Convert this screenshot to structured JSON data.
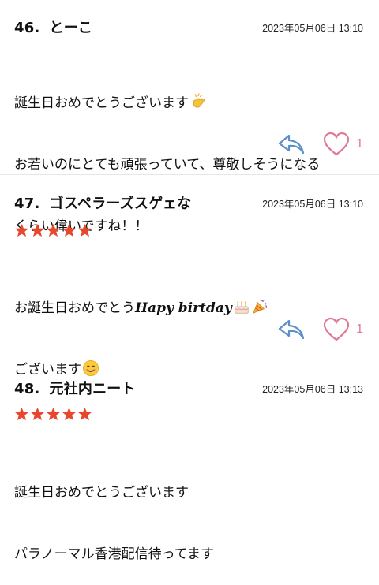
{
  "comments": [
    {
      "number": "46.",
      "name": "とーこ",
      "timestamp": "2023年05月06日 13:10",
      "stars": 0,
      "lines": [
        "誕生日おめでとうございます",
        "お若いのにとても頑張っていて、尊敬しそうになる",
        "くらい偉いですね！！"
      ],
      "likes": "1"
    },
    {
      "number": "47.",
      "name": "ゴスペラーズスゲェな",
      "timestamp": "2023年05月06日 13:10",
      "stars": 5,
      "line1_prefix": "お誕生日おめでとう",
      "line1_fancy": "Hapy birtday",
      "line2": "ございます",
      "likes": "1"
    },
    {
      "number": "48.",
      "name": "元社内ニート",
      "timestamp": "2023年05月06日 13:13",
      "stars": 5,
      "lines": [
        "誕生日おめでとうございます",
        "パラノーマル香港配信待ってます"
      ]
    }
  ],
  "colors": {
    "star": "#e8472e",
    "reply": "#5a8fc8",
    "heart": "#e07a96"
  },
  "icons": {
    "reply": "reply-arrow-icon",
    "like": "heart-outline-icon",
    "rating": "star-icon",
    "clap": "clapping-hands-emoji",
    "cake": "birthday-cake-emoji",
    "party": "party-popper-emoji",
    "smile": "smiling-face-emoji"
  }
}
